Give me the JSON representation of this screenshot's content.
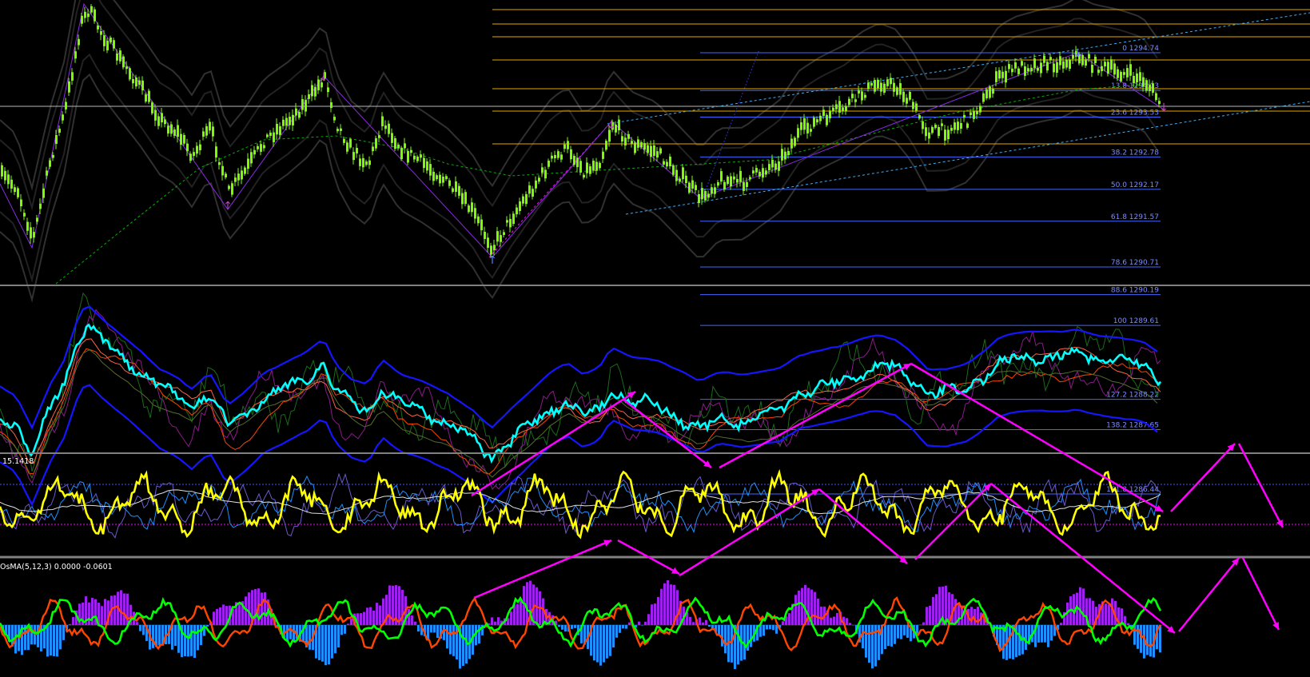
{
  "colors": {
    "background": "#000000",
    "candle": "#7cfc00",
    "fib_blue": "#4466ff",
    "fib_orange": "#e6a400",
    "fib_text": "#7b8cff",
    "trend_cyan": "#3ab0ff",
    "arrows_magenta": "#ff00ff",
    "zigzag": "#8a2be2",
    "sma_dashed": "#00b000",
    "pane2_main": "#00ffff",
    "pane2_blue": "#1515ff",
    "pane2_orange": "#ff4500",
    "pane3_main": "#ffff00",
    "osma_up": "#a020f0",
    "osma_down": "#1e90ff",
    "osma_line_green": "#00ff00",
    "osma_line_red": "#ff4500",
    "separator": "#808080"
  },
  "icons": [
    "up-arrow-fractal-icon",
    "down-arrow-fractal-icon"
  ],
  "chart_data": [
    {
      "type": "line",
      "name": "price-pane",
      "note_series": "candlestick price (visual approximation)",
      "y_levels": [
        {
          "pct": "0",
          "price": "1294.74",
          "label": "0 1294.74"
        },
        {
          "pct": "13.8",
          "price": "1294.03",
          "label": "13.8 1294.03"
        },
        {
          "pct": "23.6",
          "price": "1293.53",
          "label": "23.6 1293.53"
        },
        {
          "pct": "38.2",
          "price": "1292.78",
          "label": "38.2 1292.78"
        },
        {
          "pct": "50.0",
          "price": "1292.17",
          "label": "50.0 1292.17"
        },
        {
          "pct": "61.8",
          "price": "1291.57",
          "label": "61.8 1291.57"
        },
        {
          "pct": "78.6",
          "price": "1290.71",
          "label": "78.6 1290.71"
        },
        {
          "pct": "88.6",
          "price": "1290.19",
          "label": "88.6 1290.19"
        },
        {
          "pct": "100",
          "price": "1289.61",
          "label": "100 1289.61"
        },
        {
          "pct": "127.2",
          "price": "1288.22",
          "label": "127.2 1288.22"
        },
        {
          "pct": "138.2",
          "price": "1287.65",
          "label": "138.2 1287.65"
        },
        {
          "pct": "161.8",
          "price": "1286.44",
          "label": "161.8 1286.44"
        }
      ]
    },
    {
      "type": "line",
      "name": "oscillator-pane"
    },
    {
      "type": "line",
      "name": "stochastic-pane",
      "label": "15.1418"
    },
    {
      "type": "bar",
      "name": "osma-pane",
      "label": "OsMA(5,12,3) 0.0000 -0.0601"
    }
  ]
}
